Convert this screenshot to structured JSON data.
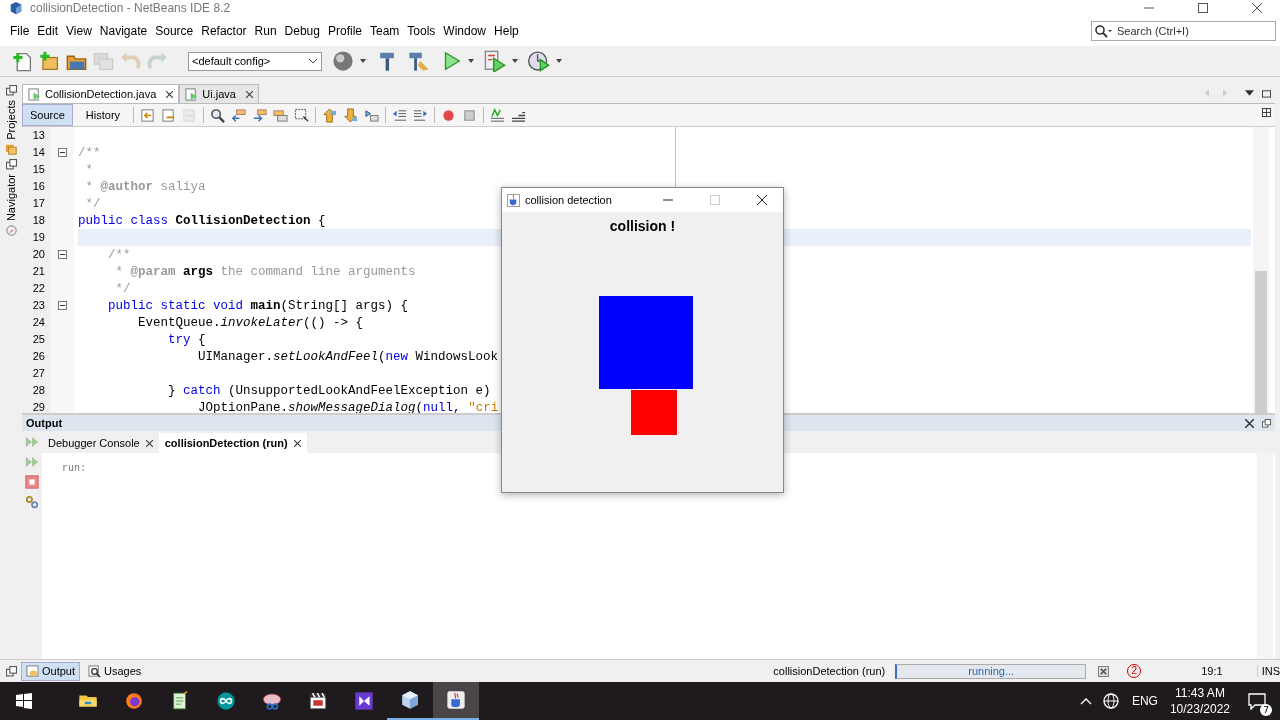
{
  "window": {
    "title": "collisionDetection - NetBeans IDE 8.2"
  },
  "menu": [
    "File",
    "Edit",
    "View",
    "Navigate",
    "Source",
    "Refactor",
    "Run",
    "Debug",
    "Profile",
    "Team",
    "Tools",
    "Window",
    "Help"
  ],
  "toolbar": {
    "left": [
      {
        "kind": "new-file",
        "disabled": false
      },
      {
        "kind": "new-project",
        "disabled": false
      },
      {
        "kind": "open-project",
        "disabled": false
      },
      {
        "kind": "close-project",
        "disabled": true
      },
      {
        "kind": "undo",
        "disabled": true
      },
      {
        "kind": "redo",
        "disabled": true
      }
    ],
    "config": "<default config>",
    "right": [
      {
        "kind": "globe",
        "disabled": false,
        "dropdown": true
      },
      {
        "kind": "hammer",
        "disabled": false,
        "dropdown": false
      },
      {
        "kind": "clean-build",
        "disabled": false,
        "dropdown": false
      },
      {
        "kind": "run",
        "disabled": false,
        "dropdown": true
      },
      {
        "kind": "debug",
        "disabled": false,
        "dropdown": true
      },
      {
        "kind": "profile",
        "disabled": false,
        "dropdown": true
      }
    ]
  },
  "search": {
    "placeholder": "Search (Ctrl+I)"
  },
  "side_tabs": [
    "Projects",
    "Navigator"
  ],
  "editor_tabs": [
    {
      "label": "CollisionDetection.java",
      "selected": true
    },
    {
      "label": "Ui.java",
      "selected": false
    }
  ],
  "source_toolbar": {
    "views": [
      {
        "label": "Source",
        "selected": true
      },
      {
        "label": "History",
        "selected": false
      }
    ],
    "tools": [
      {
        "kind": "back",
        "disabled": false
      },
      {
        "kind": "last-edit",
        "disabled": false
      },
      {
        "kind": "forward",
        "disabled": true
      },
      {
        "kind": "find",
        "disabled": false
      },
      {
        "kind": "prev",
        "disabled": false
      },
      {
        "kind": "next",
        "disabled": false
      },
      {
        "kind": "highlight",
        "disabled": false
      },
      {
        "kind": "select",
        "disabled": false
      },
      {
        "kind": "up",
        "disabled": false
      },
      {
        "kind": "down",
        "disabled": false
      },
      {
        "kind": "bookmark",
        "disabled": false
      },
      {
        "kind": "shift-left",
        "disabled": false
      },
      {
        "kind": "shift-right",
        "disabled": false
      },
      {
        "kind": "record",
        "disabled": false
      },
      {
        "kind": "stop",
        "disabled": false
      },
      {
        "kind": "check",
        "disabled": false
      },
      {
        "kind": "lines",
        "disabled": false
      }
    ]
  },
  "code": [
    {
      "number": "13",
      "foldable": false,
      "current": false
    },
    {
      "number": "14",
      "foldable": true,
      "current": false,
      "tokens": [
        {
          "text": "/**",
          "kind": "comment"
        }
      ]
    },
    {
      "number": "15",
      "foldable": false,
      "current": false,
      "tokens": [
        {
          "text": " *",
          "kind": "comment"
        }
      ]
    },
    {
      "number": "16",
      "foldable": false,
      "current": false,
      "tokens": [
        {
          "text": " * ",
          "kind": "comment"
        },
        {
          "text": "@author",
          "kind": "tag"
        },
        {
          "text": " saliya",
          "kind": "comment"
        }
      ]
    },
    {
      "number": "17",
      "foldable": false,
      "current": false,
      "tokens": [
        {
          "text": " */",
          "kind": "comment"
        }
      ]
    },
    {
      "number": "18",
      "foldable": false,
      "current": false,
      "tokens": [
        {
          "text": "public class",
          "kind": "keyword"
        },
        {
          "text": " CollisionDetection",
          "kind": "bold"
        },
        {
          "text": " {",
          "kind": "plain"
        }
      ]
    },
    {
      "number": "19",
      "foldable": false,
      "current": true
    },
    {
      "number": "20",
      "foldable": true,
      "current": false,
      "tokens": [
        {
          "text": "    /**",
          "kind": "comment"
        }
      ]
    },
    {
      "number": "21",
      "foldable": false,
      "current": false,
      "tokens": [
        {
          "text": "     * ",
          "kind": "comment"
        },
        {
          "text": "@param",
          "kind": "tag"
        },
        {
          "text": " args",
          "kind": "bold"
        },
        {
          "text": " the command line arguments",
          "kind": "comment"
        }
      ]
    },
    {
      "number": "22",
      "foldable": false,
      "current": false,
      "tokens": [
        {
          "text": "     */",
          "kind": "comment"
        }
      ]
    },
    {
      "number": "23",
      "foldable": true,
      "current": false,
      "tokens": [
        {
          "text": "    public static void",
          "kind": "keyword"
        },
        {
          "text": " main",
          "kind": "bold"
        },
        {
          "text": "(String[] args) {",
          "kind": "plain"
        }
      ]
    },
    {
      "number": "24",
      "foldable": false,
      "current": false,
      "tokens": [
        {
          "text": "        EventQueue.",
          "kind": "plain"
        },
        {
          "text": "invokeLater",
          "kind": "italic"
        },
        {
          "text": "(() -> {",
          "kind": "plain"
        }
      ]
    },
    {
      "number": "25",
      "foldable": false,
      "current": false,
      "tokens": [
        {
          "text": "            try",
          "kind": "keyword"
        },
        {
          "text": " {",
          "kind": "plain"
        }
      ]
    },
    {
      "number": "26",
      "foldable": false,
      "current": false,
      "tokens": [
        {
          "text": "                UIManager.",
          "kind": "plain"
        },
        {
          "text": "setLookAndFeel",
          "kind": "italic"
        },
        {
          "text": "(",
          "kind": "plain"
        },
        {
          "text": "new",
          "kind": "keyword"
        },
        {
          "text": " WindowsLook",
          "kind": "plain"
        }
      ]
    },
    {
      "number": "27",
      "foldable": false,
      "current": false
    },
    {
      "number": "28",
      "foldable": false,
      "current": false,
      "tokens": [
        {
          "text": "            }",
          "kind": "plain"
        },
        {
          "text": " catch",
          "kind": "keyword"
        },
        {
          "text": " (UnsupportedLookAndFeelException e)",
          "kind": "plain"
        }
      ]
    },
    {
      "number": "29",
      "foldable": false,
      "current": false,
      "tokens": [
        {
          "text": "                JOptionPane.",
          "kind": "plain"
        },
        {
          "text": "showMessageDialog",
          "kind": "italic"
        },
        {
          "text": "(",
          "kind": "plain"
        },
        {
          "text": "null",
          "kind": "keyword"
        },
        {
          "text": ",",
          "kind": "plain"
        },
        {
          "text": " \"cri",
          "kind": "string"
        }
      ]
    }
  ],
  "output": {
    "title": "Output",
    "tabs": [
      {
        "label": "Debugger Console",
        "selected": false
      },
      {
        "label": "collisionDetection (run)",
        "selected": true
      }
    ],
    "text": "run:"
  },
  "app_window": {
    "title": "collision detection",
    "heading": "collision !",
    "shapes": [
      {
        "kind": "large",
        "color": "#0000ff"
      },
      {
        "kind": "small",
        "color": "#ff0000"
      }
    ]
  },
  "status_bar": {
    "views": [
      {
        "label": "Output",
        "selected": true
      },
      {
        "label": "Usages",
        "selected": false
      }
    ],
    "task": "collisionDetection (run)",
    "progress": "running...",
    "notifications": "2",
    "position": "19:1",
    "mode": "INS"
  },
  "taskbar": {
    "apps": [
      {
        "kind": "folder",
        "selected": false,
        "running": false
      },
      {
        "kind": "browser",
        "selected": false,
        "running": false
      },
      {
        "kind": "notepad",
        "selected": false,
        "running": false
      },
      {
        "kind": "infinity",
        "selected": false,
        "running": false
      },
      {
        "kind": "scissors",
        "selected": false,
        "running": false
      },
      {
        "kind": "clapper",
        "selected": false,
        "running": false
      },
      {
        "kind": "ribbon",
        "selected": false,
        "running": false
      },
      {
        "kind": "cube",
        "selected": false,
        "running": true
      },
      {
        "kind": "cup",
        "selected": true,
        "running": true
      }
    ],
    "language": "ENG",
    "time": "11:43 AM",
    "date": "10/23/2022",
    "notifications": "7"
  }
}
